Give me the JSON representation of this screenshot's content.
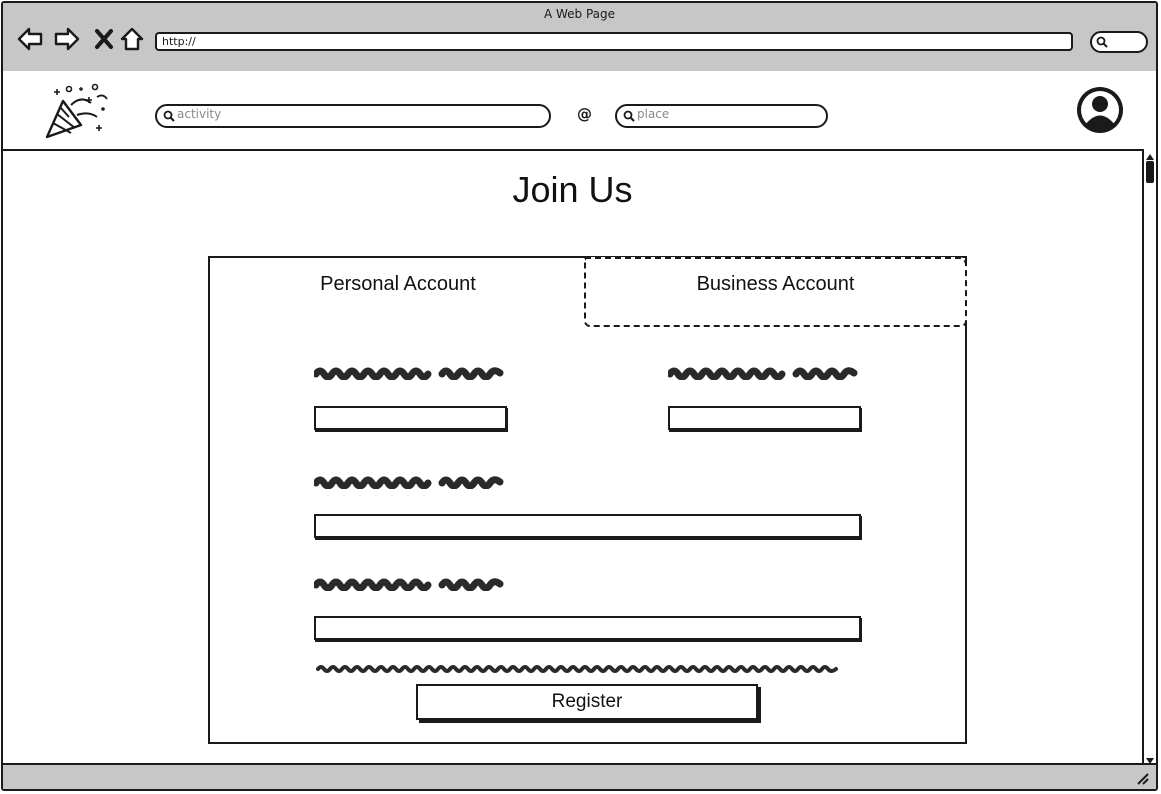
{
  "browser": {
    "window_title": "A Web Page",
    "url": "http://",
    "icons": [
      "back-icon",
      "forward-icon",
      "stop-icon",
      "home-icon",
      "search-icon"
    ]
  },
  "header": {
    "logo_icon": "party-popper-icon",
    "activity_placeholder": "activity",
    "at_symbol": "@",
    "place_placeholder": "place",
    "avatar_icon": "user-avatar-icon"
  },
  "main": {
    "title": "Join Us",
    "tabs": [
      {
        "label": "Personal Account",
        "selected": true
      },
      {
        "label": "Business Account",
        "selected": false
      }
    ],
    "register_label": "Register"
  },
  "colors": {
    "chrome": "#c7c7c7",
    "ink": "#1a1a1a"
  }
}
